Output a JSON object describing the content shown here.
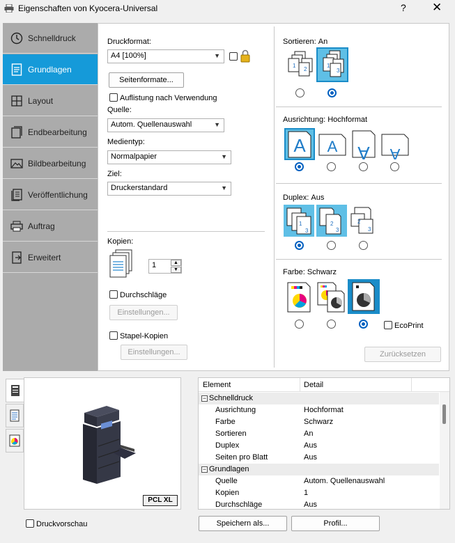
{
  "window": {
    "title": "Eigenschaften von Kyocera-Universal",
    "help": "?",
    "close": "✕"
  },
  "sidebar": {
    "items": [
      {
        "label": "Schnelldruck",
        "icon": "clock-icon"
      },
      {
        "label": "Grundlagen",
        "icon": "document-icon"
      },
      {
        "label": "Layout",
        "icon": "layout-grid-icon"
      },
      {
        "label": "Endbearbeitung",
        "icon": "finishing-icon"
      },
      {
        "label": "Bildbearbeitung",
        "icon": "image-icon"
      },
      {
        "label": "Veröffentlichung",
        "icon": "publishing-icon"
      },
      {
        "label": "Auftrag",
        "icon": "job-icon"
      },
      {
        "label": "Erweitert",
        "icon": "advanced-icon"
      }
    ],
    "active_index": 1
  },
  "basics": {
    "druckformat_label": "Druckformat:",
    "druckformat_value": "A4  [100%]",
    "seitenformate_button": "Seitenformate...",
    "auflistung_label": "Auflistung nach Verwendung",
    "quelle_label": "Quelle:",
    "quelle_value": "Autom. Quellenauswahl",
    "medientyp_label": "Medientyp:",
    "medientyp_value": "Normalpapier",
    "ziel_label": "Ziel:",
    "ziel_value": "Druckerstandard",
    "kopien_label": "Kopien:",
    "kopien_value": "1",
    "durchschlaege_label": "Durchschläge",
    "einstellungen1": "Einstellungen...",
    "stapel_label": "Stapel-Kopien",
    "einstellungen2": "Einstellungen..."
  },
  "options": {
    "sortieren_label": "Sortieren:",
    "sortieren_value": "An",
    "ausrichtung_label": "Ausrichtung:",
    "ausrichtung_value": "Hochformat",
    "duplex_label": "Duplex:",
    "duplex_value": "Aus",
    "farbe_label": "Farbe:",
    "farbe_value": "Schwarz",
    "ecoprint_label": "EcoPrint",
    "zuruecksetzen": "Zurücksetzen",
    "orientation_glyph": "A",
    "duplex_digits": [
      "1",
      "2",
      "3"
    ],
    "sort_digits": [
      "1",
      "2",
      "3"
    ]
  },
  "preview": {
    "pcl_label": "PCL XL",
    "druckvorschau_label": "Druckvorschau"
  },
  "summary": {
    "col_element": "Element",
    "col_detail": "Detail",
    "rows": [
      {
        "element": "Schnelldruck",
        "detail": "",
        "section": true
      },
      {
        "element": "Ausrichtung",
        "detail": "Hochformat",
        "section": false
      },
      {
        "element": "Farbe",
        "detail": "Schwarz",
        "section": false
      },
      {
        "element": "Sortieren",
        "detail": "An",
        "section": false
      },
      {
        "element": "Duplex",
        "detail": "Aus",
        "section": false
      },
      {
        "element": "Seiten pro Blatt",
        "detail": "Aus",
        "section": false
      },
      {
        "element": "Grundlagen",
        "detail": "",
        "section": true
      },
      {
        "element": "Quelle",
        "detail": "Autom. Quellenauswahl",
        "section": false
      },
      {
        "element": "Kopien",
        "detail": "1",
        "section": false
      },
      {
        "element": "Durchschläge",
        "detail": "Aus",
        "section": false
      }
    ]
  },
  "footer": {
    "speichern_button": "Speichern als...",
    "profil_button": "Profil..."
  },
  "colors": {
    "accent": "#159ad9",
    "selected_tile": "#5fbfe6"
  }
}
